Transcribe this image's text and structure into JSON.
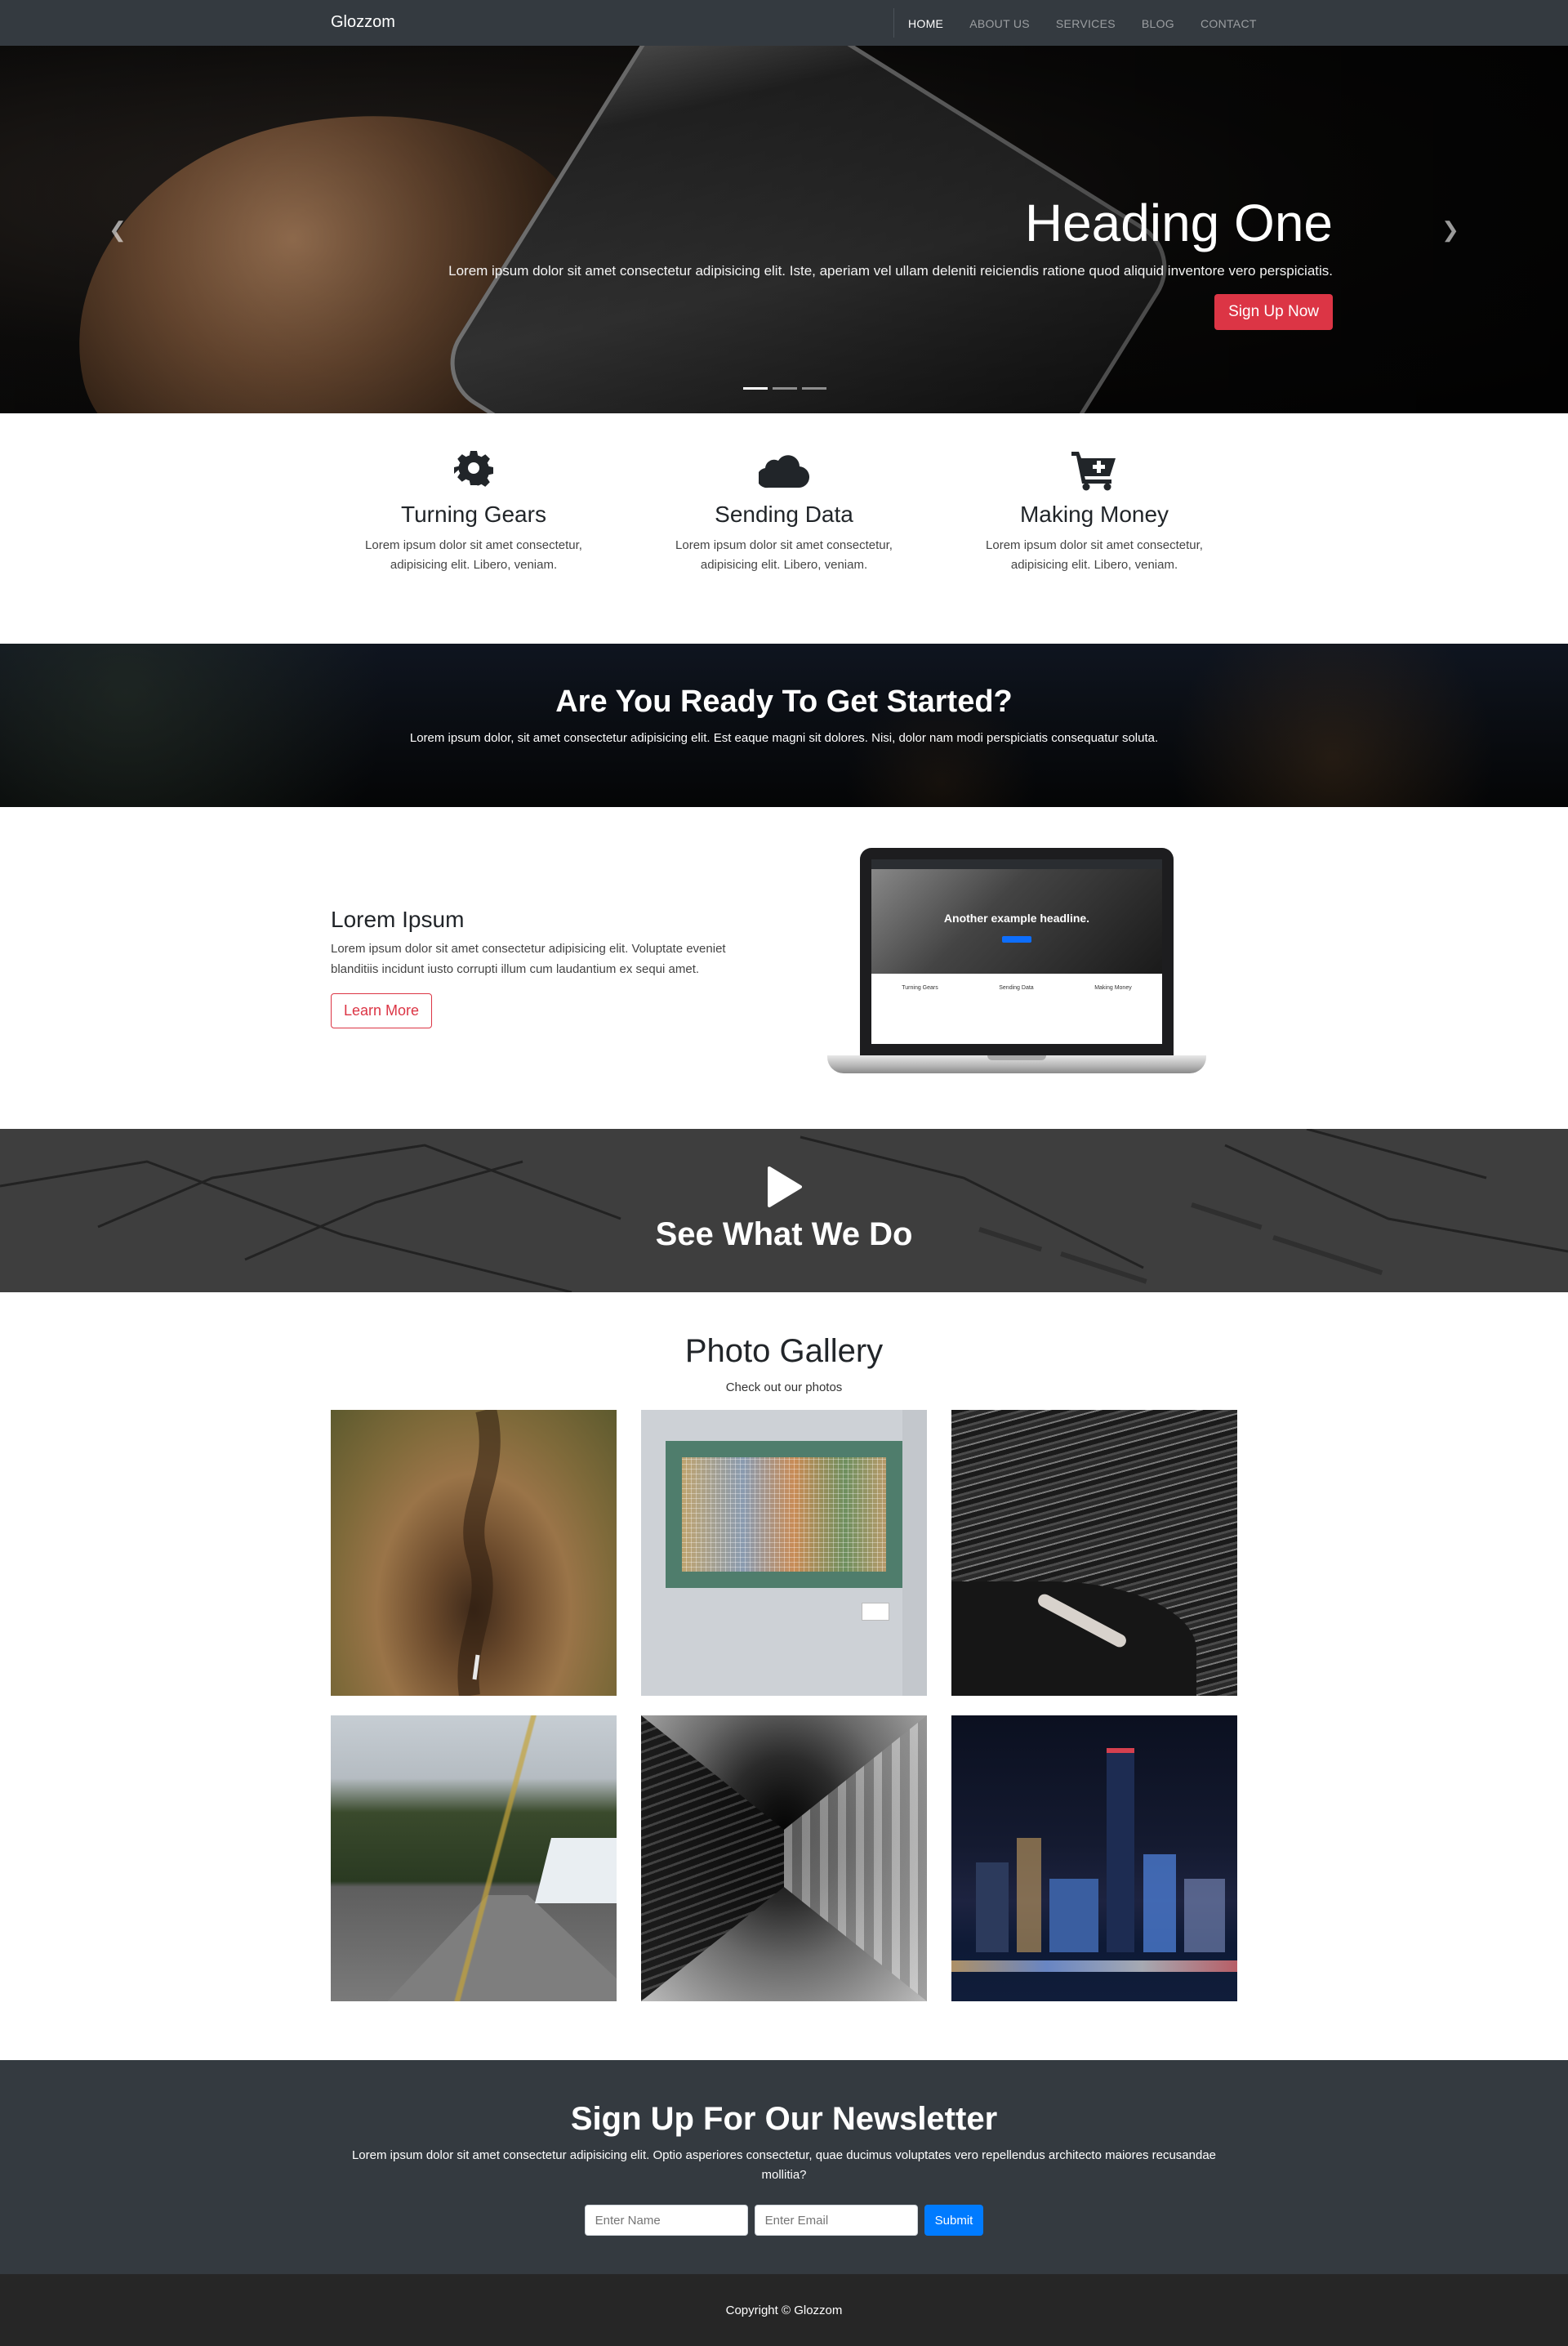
{
  "navbar": {
    "brand": "Glozzom",
    "links": [
      "HOME",
      "ABOUT US",
      "SERVICES",
      "BLOG",
      "CONTACT"
    ]
  },
  "hero": {
    "heading": "Heading One",
    "text": "Lorem ipsum dolor sit amet consectetur adipisicing elit. Iste, aperiam vel ullam deleniti reiciendis ratione quod aliquid inventore vero perspiciatis.",
    "cta": "Sign Up Now",
    "prev_icon": "chevron-left-icon",
    "next_icon": "chevron-right-icon",
    "slides": 3,
    "active_slide": 1
  },
  "features": [
    {
      "icon": "gear-icon",
      "title": "Turning Gears",
      "text": "Lorem ipsum dolor sit amet consectetur, adipisicing elit. Libero, veniam."
    },
    {
      "icon": "cloud-icon",
      "title": "Sending Data",
      "text": "Lorem ipsum dolor sit amet consectetur, adipisicing elit. Libero, veniam."
    },
    {
      "icon": "cart-plus-icon",
      "title": "Making Money",
      "text": "Lorem ipsum dolor sit amet consectetur, adipisicing elit. Libero, veniam."
    }
  ],
  "ready": {
    "title": "Are You Ready To Get Started?",
    "text": "Lorem ipsum dolor, sit amet consectetur adipisicing elit. Est eaque magni sit dolores. Nisi, dolor nam modi perspiciatis consequatur soluta."
  },
  "info": {
    "title": "Lorem Ipsum",
    "text": "Lorem ipsum dolor sit amet consectetur adipisicing elit. Voluptate eveniet blanditiis incidunt iusto corrupti illum cum laudantium ex sequi amet.",
    "button": "Learn More",
    "laptop_headline": "Another example headline."
  },
  "video": {
    "title": "See What We Do",
    "icon": "play-icon"
  },
  "gallery": {
    "title": "Photo Gallery",
    "subtitle": "Check out our photos",
    "photos": [
      "canyon-waterfall",
      "pixel-art-frame",
      "woman-on-rock",
      "mountain-road",
      "train-tunnel",
      "city-night"
    ]
  },
  "newsletter": {
    "title": "Sign Up For Our Newsletter",
    "text": "Lorem ipsum dolor sit amet consectetur adipisicing elit. Optio asperiores consectetur, quae ducimus voluptates vero repellendus architecto maiores recusandae mollitia?",
    "name_placeholder": "Enter Name",
    "email_placeholder": "Enter Email",
    "submit": "Submit"
  },
  "footer": {
    "copyright": "Copyright © Glozzom"
  },
  "colors": {
    "dark": "#343a40",
    "danger": "#dc3545",
    "primary": "#007bff",
    "footer": "#262626"
  }
}
